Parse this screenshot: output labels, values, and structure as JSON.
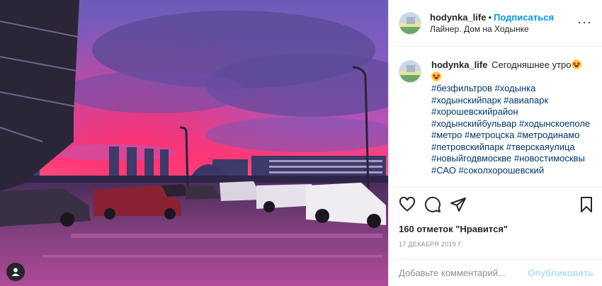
{
  "post": {
    "photo_alt": "",
    "author": {
      "username": "hodynka_life",
      "follow_label": "Подписаться",
      "location": "Лайнер. Дом на Ходынке"
    },
    "more_icon": "more-horizontal-icon",
    "caption": {
      "username": "hodynka_life",
      "text": "Сегодняшнее утро",
      "hashtags": "#безфильтров #ходынка #ходынскийпарк #авиапарк #хорошевскийрайон #ходынскийбульвар #ходынскоеполе #метро #метроцска #метродинамо #петровскийпарк #тверскаяулица #новыйгодвмоскве #новостимосквы #САО #соколхорошевский"
    },
    "actions": {
      "icons": [
        "heart-icon",
        "comment-icon",
        "share-icon",
        "bookmark-icon"
      ]
    },
    "likes": "160 отметок \"Нравится\"",
    "date": "17 ДЕКАБРЯ 2019 Г.",
    "comment_box": {
      "placeholder": "Добавьте комментарий...",
      "publish_label": "Опубликовать"
    },
    "colors": {
      "accent": "#0095f6",
      "hashtag": "#00376b",
      "publish_disabled": "#b2dffc",
      "sky_pink": "#ff4a8a",
      "sky_purple": "#7a4fc8"
    }
  }
}
